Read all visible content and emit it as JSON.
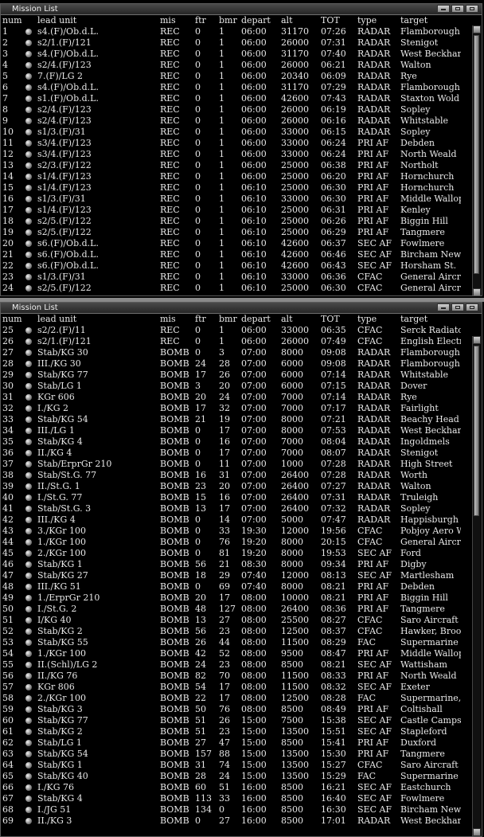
{
  "columns": [
    "num",
    "lead unit",
    "mis",
    "ftr",
    "bmr",
    "depart",
    "alt",
    "TOT",
    "type",
    "target"
  ],
  "window1": {
    "title": "Mission List",
    "rows": [
      [
        "1",
        "s4.(F)/Ob.d.L.",
        "REC",
        "0",
        "1",
        "06:00",
        "31170",
        "07:26",
        "RADAR",
        "Flamborough"
      ],
      [
        "2",
        "s2/1.(F)/121",
        "REC",
        "0",
        "1",
        "06:00",
        "26000",
        "07:31",
        "RADAR",
        "Stenigot"
      ],
      [
        "3",
        "s4.(F)/Ob.d.L.",
        "REC",
        "0",
        "1",
        "06:00",
        "31170",
        "07:40",
        "RADAR",
        "West Beckhar"
      ],
      [
        "4",
        "s2/4.(F)/123",
        "REC",
        "0",
        "1",
        "06:00",
        "26000",
        "06:21",
        "RADAR",
        "Walton"
      ],
      [
        "5",
        "7.(F)/LG 2",
        "REC",
        "0",
        "1",
        "06:00",
        "20340",
        "06:09",
        "RADAR",
        "Rye"
      ],
      [
        "6",
        "s4.(F)/Ob.d.L.",
        "REC",
        "0",
        "1",
        "06:00",
        "31170",
        "07:29",
        "RADAR",
        "Flamborough"
      ],
      [
        "7",
        "s1.(F)/Ob.d.L.",
        "REC",
        "0",
        "1",
        "06:00",
        "42600",
        "07:43",
        "RADAR",
        "Staxton Wold"
      ],
      [
        "8",
        "s2/4.(F)/123",
        "REC",
        "0",
        "1",
        "06:00",
        "26000",
        "06:19",
        "RADAR",
        "Sopley"
      ],
      [
        "9",
        "s2/4.(F)/123",
        "REC",
        "0",
        "1",
        "06:00",
        "26000",
        "06:16",
        "RADAR",
        "Whitstable"
      ],
      [
        "10",
        "s1/3.(F)/31",
        "REC",
        "0",
        "1",
        "06:00",
        "33000",
        "06:15",
        "RADAR",
        "Sopley"
      ],
      [
        "11",
        "s3/4.(F)/123",
        "REC",
        "0",
        "1",
        "06:00",
        "33000",
        "06:24",
        "PRI AF",
        "Debden"
      ],
      [
        "12",
        "s3/4.(F)/123",
        "REC",
        "0",
        "1",
        "06:00",
        "33000",
        "06:24",
        "PRI AF",
        "North Weald"
      ],
      [
        "13",
        "s2/3.(F)/122",
        "REC",
        "0",
        "1",
        "06:00",
        "25000",
        "06:38",
        "PRI AF",
        "Northolt"
      ],
      [
        "14",
        "s1/4.(F)/123",
        "REC",
        "0",
        "1",
        "06:00",
        "25000",
        "06:20",
        "PRI AF",
        "Hornchurch"
      ],
      [
        "15",
        "s1/4.(F)/123",
        "REC",
        "0",
        "1",
        "06:10",
        "25000",
        "06:30",
        "PRI AF",
        "Hornchurch"
      ],
      [
        "16",
        "s1/3.(F)/31",
        "REC",
        "0",
        "1",
        "06:10",
        "33000",
        "06:30",
        "PRI AF",
        "Middle Wallop"
      ],
      [
        "17",
        "s1/4.(F)/123",
        "REC",
        "0",
        "1",
        "06:10",
        "25000",
        "06:31",
        "PRI AF",
        "Kenley"
      ],
      [
        "18",
        "s2/5.(F)/122",
        "REC",
        "0",
        "1",
        "06:10",
        "25000",
        "06:26",
        "PRI AF",
        "Biggin Hill"
      ],
      [
        "19",
        "s2/5.(F)/122",
        "REC",
        "0",
        "1",
        "06:10",
        "25000",
        "06:29",
        "PRI AF",
        "Tangmere"
      ],
      [
        "20",
        "s6.(F)/Ob.d.L.",
        "REC",
        "0",
        "1",
        "06:10",
        "42600",
        "06:37",
        "SEC AF",
        "Fowlmere"
      ],
      [
        "21",
        "s6.(F)/Ob.d.L.",
        "REC",
        "0",
        "1",
        "06:10",
        "42600",
        "06:46",
        "SEC AF",
        "Bircham New"
      ],
      [
        "22",
        "s6.(F)/Ob.d.L.",
        "REC",
        "0",
        "1",
        "06:10",
        "42600",
        "06:43",
        "SEC AF",
        "Horsham St."
      ],
      [
        "23",
        "s1/3.(F)/31",
        "REC",
        "0",
        "1",
        "06:10",
        "33000",
        "06:36",
        "CFAC",
        "General Aircr"
      ],
      [
        "24",
        "s2/5.(F)/122",
        "REC",
        "0",
        "1",
        "06:10",
        "25000",
        "06:30",
        "CFAC",
        "General Aircr"
      ]
    ]
  },
  "window2": {
    "title": "Mission List",
    "rows": [
      [
        "25",
        "s2/2.(F)/11",
        "REC",
        "0",
        "1",
        "06:00",
        "33000",
        "06:35",
        "CFAC",
        "Serck Radiato"
      ],
      [
        "26",
        "s2/1.(F)/121",
        "REC",
        "0",
        "1",
        "06:00",
        "26000",
        "07:49",
        "CFAC",
        "English Electr"
      ],
      [
        "27",
        "Stab/KG 30",
        "BOMB",
        "0",
        "3",
        "07:00",
        "8000",
        "09:08",
        "RADAR",
        "Flamborough"
      ],
      [
        "28",
        "III./KG 30",
        "BOMB",
        "24",
        "28",
        "07:00",
        "6000",
        "09:08",
        "RADAR",
        "Flamborough"
      ],
      [
        "29",
        "Stab/KG 77",
        "BOMB",
        "17",
        "26",
        "07:00",
        "6000",
        "07:14",
        "RADAR",
        "Whitstable"
      ],
      [
        "30",
        "Stab/LG 1",
        "BOMB",
        "3",
        "20",
        "07:00",
        "6000",
        "07:15",
        "RADAR",
        "Dover"
      ],
      [
        "31",
        "KGr 606",
        "BOMB",
        "20",
        "24",
        "07:00",
        "7000",
        "07:14",
        "RADAR",
        "Rye"
      ],
      [
        "32",
        "I./KG 2",
        "BOMB",
        "17",
        "32",
        "07:00",
        "7000",
        "07:17",
        "RADAR",
        "Fairlight"
      ],
      [
        "33",
        "Stab/KG 54",
        "BOMB",
        "21",
        "19",
        "07:00",
        "8000",
        "07:21",
        "RADAR",
        "Beachy Head"
      ],
      [
        "34",
        "III./LG 1",
        "BOMB",
        "0",
        "17",
        "07:00",
        "8000",
        "07:53",
        "RADAR",
        "West Beckhar"
      ],
      [
        "35",
        "Stab/KG 4",
        "BOMB",
        "0",
        "16",
        "07:00",
        "7000",
        "08:04",
        "RADAR",
        "Ingoldmels"
      ],
      [
        "36",
        "II./KG 4",
        "BOMB",
        "0",
        "17",
        "07:00",
        "7000",
        "08:07",
        "RADAR",
        "Stenigot"
      ],
      [
        "37",
        "Stab/ErprGr 210",
        "BOMB",
        "0",
        "11",
        "07:00",
        "1000",
        "07:28",
        "RADAR",
        "High Street"
      ],
      [
        "38",
        "Stab/St.G. 77",
        "BOMB",
        "16",
        "31",
        "07:00",
        "26400",
        "07:28",
        "RADAR",
        "Worth"
      ],
      [
        "39",
        "II./St.G. 1",
        "BOMB",
        "23",
        "20",
        "07:00",
        "26400",
        "07:27",
        "RADAR",
        "Walton"
      ],
      [
        "40",
        "I./St.G. 77",
        "BOMB",
        "15",
        "16",
        "07:00",
        "26400",
        "07:31",
        "RADAR",
        "Truleigh"
      ],
      [
        "41",
        "Stab/St.G. 3",
        "BOMB",
        "13",
        "17",
        "07:00",
        "26400",
        "07:32",
        "RADAR",
        "Sopley"
      ],
      [
        "42",
        "III./KG 4",
        "BOMB",
        "0",
        "14",
        "07:00",
        "5000",
        "07:47",
        "RADAR",
        "Happisburgh"
      ],
      [
        "43",
        "3./KGr 100",
        "BOMB",
        "0",
        "33",
        "19:30",
        "12000",
        "19:56",
        "CFAC",
        "Pobjoy Aero W"
      ],
      [
        "44",
        "1./KGr 100",
        "BOMB",
        "0",
        "76",
        "19:20",
        "8000",
        "20:15",
        "CFAC",
        "General Aircr"
      ],
      [
        "45",
        "2./KGr 100",
        "BOMB",
        "0",
        "81",
        "19:20",
        "8000",
        "19:53",
        "SEC AF",
        "Ford"
      ],
      [
        "46",
        "Stab/KG 1",
        "BOMB",
        "56",
        "21",
        "08:30",
        "8000",
        "09:34",
        "PRI AF",
        "Digby"
      ],
      [
        "47",
        "Stab/KG 27",
        "BOMB",
        "18",
        "29",
        "07:40",
        "12000",
        "08:13",
        "SEC AF",
        "Martlesham"
      ],
      [
        "48",
        "III./KG 51",
        "BOMB",
        "0",
        "69",
        "07:40",
        "8000",
        "08:21",
        "PRI AF",
        "Debden"
      ],
      [
        "49",
        "1./ErprGr 210",
        "BOMB",
        "20",
        "17",
        "08:00",
        "10000",
        "08:21",
        "PRI AF",
        "Biggin Hill"
      ],
      [
        "50",
        "I./St.G. 2",
        "BOMB",
        "48",
        "127",
        "08:00",
        "26400",
        "08:36",
        "PRI AF",
        "Tangmere"
      ],
      [
        "51",
        "I/KG 40",
        "BOMB",
        "13",
        "27",
        "08:00",
        "25500",
        "08:27",
        "CFAC",
        "Saro Aircraft"
      ],
      [
        "52",
        "Stab/KG 2",
        "BOMB",
        "56",
        "23",
        "08:00",
        "12500",
        "08:37",
        "CFAC",
        "Hawker, Broo"
      ],
      [
        "53",
        "Stab/KG 55",
        "BOMB",
        "26",
        "44",
        "08:00",
        "11500",
        "08:29",
        "FAC",
        "Supermarine"
      ],
      [
        "54",
        "1./KGr 100",
        "BOMB",
        "42",
        "52",
        "08:00",
        "9500",
        "08:47",
        "PRI AF",
        "Middle Wallop"
      ],
      [
        "55",
        "II.(Schl)/LG 2",
        "BOMB",
        "24",
        "23",
        "08:00",
        "8500",
        "08:21",
        "SEC AF",
        "Wattisham"
      ],
      [
        "56",
        "II./KG 76",
        "BOMB",
        "82",
        "70",
        "08:00",
        "11500",
        "08:33",
        "PRI AF",
        "North Weald"
      ],
      [
        "57",
        "KGr 806",
        "BOMB",
        "54",
        "17",
        "08:00",
        "11500",
        "08:32",
        "SEC AF",
        "Exeter"
      ],
      [
        "58",
        "2./KGr 100",
        "BOMB",
        "22",
        "17",
        "08:00",
        "12500",
        "08:28",
        "FAC",
        "Supermarine,"
      ],
      [
        "59",
        "Stab/KG 3",
        "BOMB",
        "50",
        "76",
        "08:00",
        "8500",
        "08:49",
        "PRI AF",
        "Coltishall"
      ],
      [
        "60",
        "Stab/KG 77",
        "BOMB",
        "51",
        "26",
        "15:00",
        "7500",
        "15:38",
        "SEC AF",
        "Castle Camps"
      ],
      [
        "61",
        "Stab/KG 2",
        "BOMB",
        "51",
        "23",
        "15:00",
        "13500",
        "15:51",
        "SEC AF",
        "Stapleford"
      ],
      [
        "62",
        "Stab/LG 1",
        "BOMB",
        "27",
        "47",
        "15:00",
        "8500",
        "15:41",
        "PRI AF",
        "Duxford"
      ],
      [
        "63",
        "Stab/KG 54",
        "BOMB",
        "157",
        "88",
        "15:00",
        "13500",
        "15:30",
        "PRI AF",
        "Tangmere"
      ],
      [
        "64",
        "Stab/KG 1",
        "BOMB",
        "31",
        "74",
        "15:00",
        "13500",
        "15:27",
        "CFAC",
        "Saro Aircraft"
      ],
      [
        "65",
        "Stab/KG 40",
        "BOMB",
        "28",
        "24",
        "15:00",
        "13500",
        "15:29",
        "FAC",
        "Supermarine"
      ],
      [
        "66",
        "I./KG 76",
        "BOMB",
        "60",
        "51",
        "16:00",
        "8500",
        "16:21",
        "SEC AF",
        "Eastchurch"
      ],
      [
        "67",
        "Stab/KG 4",
        "BOMB",
        "113",
        "33",
        "16:00",
        "8500",
        "16:40",
        "SEC AF",
        "Fowlmere"
      ],
      [
        "68",
        "I./JG 51",
        "BOMB",
        "134",
        "0",
        "16:00",
        "8500",
        "16:30",
        "SEC AF",
        "Bircham New"
      ],
      [
        "69",
        "II./KG 3",
        "BOMB",
        "0",
        "27",
        "16:00",
        "8500",
        "17:01",
        "RADAR",
        "West Beckhar"
      ]
    ]
  }
}
